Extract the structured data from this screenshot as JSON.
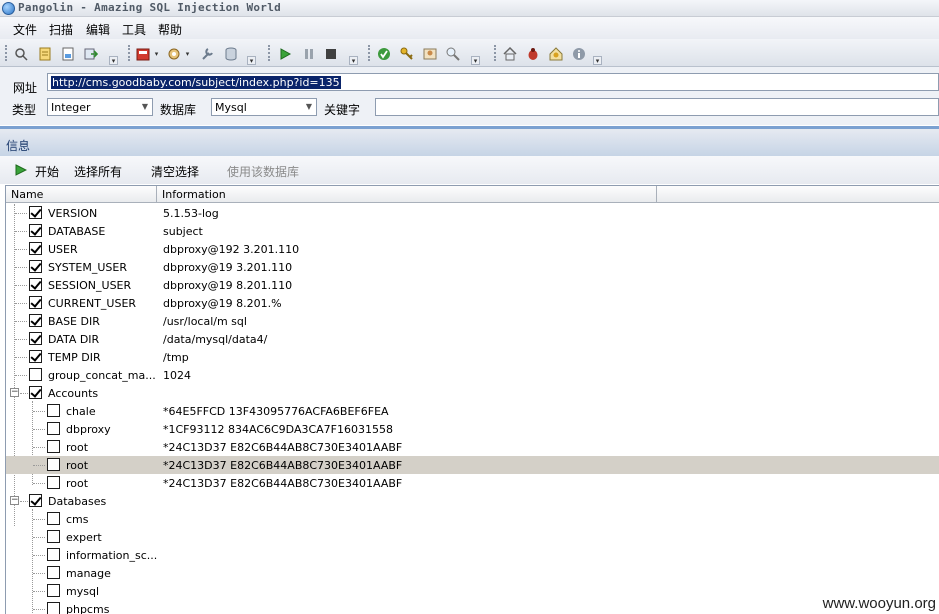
{
  "window": {
    "title": "Pangolin - Amazing SQL Injection World"
  },
  "menu": {
    "items": [
      "文件",
      "扫描",
      "编辑",
      "工具",
      "帮助"
    ]
  },
  "toolbar": {
    "icons": [
      "search-icon",
      "document-icon",
      "page-icon",
      "export-icon",
      "book-icon",
      "settings-icon",
      "wrench-icon",
      "database-icon",
      "play-icon",
      "pause-icon",
      "stop-icon",
      "help-icon",
      "key-icon",
      "user-icon",
      "magnifier-icon",
      "home-icon",
      "bug-icon",
      "star-icon",
      "info-icon"
    ]
  },
  "form": {
    "url_label": "网址",
    "url_value": "http://cms.goodbaby.com/subject/index.php?id=135",
    "type_label": "类型",
    "type_value": "Integer",
    "db_label": "数据库",
    "db_value": "Mysql",
    "keyword_label": "关键字",
    "keyword_value": ""
  },
  "info_panel": {
    "title": "信息"
  },
  "actions": {
    "start": "开始",
    "select_all": "选择所有",
    "clear": "清空选择",
    "use_db": "使用该数据库"
  },
  "columns": {
    "name": "Name",
    "information": "Information"
  },
  "rows": [
    {
      "name": "VERSION",
      "value": "5.1.53-log"
    },
    {
      "name": "DATABASE",
      "value": "subject"
    },
    {
      "name": "USER",
      "value": "dbproxy@192    3.201.110"
    },
    {
      "name": "SYSTEM_USER",
      "value": "dbproxy@19     3.201.110"
    },
    {
      "name": "SESSION_USER",
      "value": "dbproxy@19    8.201.110"
    },
    {
      "name": "CURRENT_USER",
      "value": "dbproxy@19       8.201.%"
    },
    {
      "name": "BASE DIR",
      "value": "/usr/local/m  sql"
    },
    {
      "name": "DATA DIR",
      "value": "/data/mysql/data4/"
    },
    {
      "name": "TEMP DIR",
      "value": "/tmp"
    },
    {
      "name": "group_concat_ma...",
      "value": "1024"
    },
    {
      "name": "Accounts",
      "value": ""
    },
    {
      "name": "chale",
      "value": "*64E5FFCD        13F43095776ACFA6BEF6FEA"
    },
    {
      "name": "dbproxy",
      "value": "*1CF93112       834AC6C9DA3CA7F16031558"
    },
    {
      "name": "root",
      "value": "*24C13D37        E82C6B44AB8C730E3401AABF"
    },
    {
      "name": "root",
      "value": "*24C13D37        E82C6B44AB8C730E3401AABF"
    },
    {
      "name": "root",
      "value": "*24C13D37        E82C6B44AB8C730E3401AABF"
    },
    {
      "name": "Databases",
      "value": ""
    },
    {
      "name": "cms",
      "value": ""
    },
    {
      "name": "expert",
      "value": ""
    },
    {
      "name": "information_sc...",
      "value": ""
    },
    {
      "name": "manage",
      "value": ""
    },
    {
      "name": "mysql",
      "value": ""
    },
    {
      "name": "phpcms",
      "value": ""
    }
  ],
  "watermark": "www.wooyun.org"
}
